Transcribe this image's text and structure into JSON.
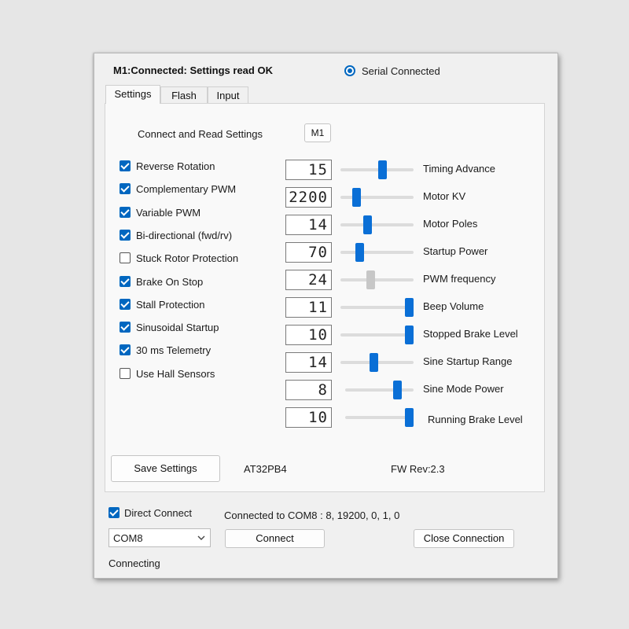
{
  "header": {
    "status_text": "M1:Connected: Settings read OK",
    "serial_label": "Serial Connected",
    "serial_checked": true
  },
  "tabs": [
    {
      "label": "Settings",
      "active": true
    },
    {
      "label": "Flash",
      "active": false
    },
    {
      "label": "Input",
      "active": false
    }
  ],
  "settings": {
    "connect_read_label": "Connect and Read Settings",
    "motor_button_label": "M1",
    "checkboxes": [
      {
        "label": "Reverse Rotation",
        "checked": true
      },
      {
        "label": "Complementary PWM",
        "checked": true
      },
      {
        "label": "Variable PWM",
        "checked": true
      },
      {
        "label": "Bi-directional (fwd/rv)",
        "checked": true
      },
      {
        "label": "Stuck Rotor Protection",
        "checked": false
      },
      {
        "label": "Brake On Stop",
        "checked": true
      },
      {
        "label": "Stall Protection",
        "checked": true
      },
      {
        "label": "Sinusoidal Startup",
        "checked": true
      },
      {
        "label": "30 ms Telemetry",
        "checked": true
      },
      {
        "label": "Use Hall Sensors",
        "checked": false
      }
    ],
    "sliders": [
      {
        "label": "Timing Advance",
        "value": "15",
        "level": 0.59,
        "enabled": true
      },
      {
        "label": "Motor KV",
        "value": "2200",
        "level": 0.18,
        "enabled": true
      },
      {
        "label": "Motor Poles",
        "value": "14",
        "level": 0.35,
        "enabled": true
      },
      {
        "label": "Startup Power",
        "value": "70",
        "level": 0.23,
        "enabled": true
      },
      {
        "label": "PWM frequency",
        "value": "24",
        "level": 0.4,
        "enabled": false
      },
      {
        "label": "Beep Volume",
        "value": "11",
        "level": 1.0,
        "enabled": true
      },
      {
        "label": "Stopped Brake Level",
        "value": "10",
        "level": 1.0,
        "enabled": true
      },
      {
        "label": "Sine Startup Range",
        "value": "14",
        "level": 0.45,
        "enabled": true
      },
      {
        "label": "Sine Mode Power",
        "value": "8",
        "level": 0.8,
        "enabled": true
      },
      {
        "label": "Running Brake Level",
        "value": "10",
        "level": 1.0,
        "enabled": true
      }
    ],
    "save_button_label": "Save Settings",
    "mcu_text": "AT32PB4",
    "fw_text": "FW Rev:2.3"
  },
  "connection": {
    "direct_connect_label": "Direct Connect",
    "direct_connect_checked": true,
    "connected_text": "Connected to COM8 : 8, 19200, 0, 1, 0",
    "port_value": "COM8",
    "connect_button_label": "Connect",
    "close_button_label": "Close Connection",
    "status_text": "Connecting"
  },
  "colors": {
    "accent": "#0067c0",
    "slider_thumb": "#0a6fd6",
    "slider_thumb_disabled": "#c7c7c7"
  },
  "icons": {
    "dropdown": "chevron-down-icon"
  }
}
